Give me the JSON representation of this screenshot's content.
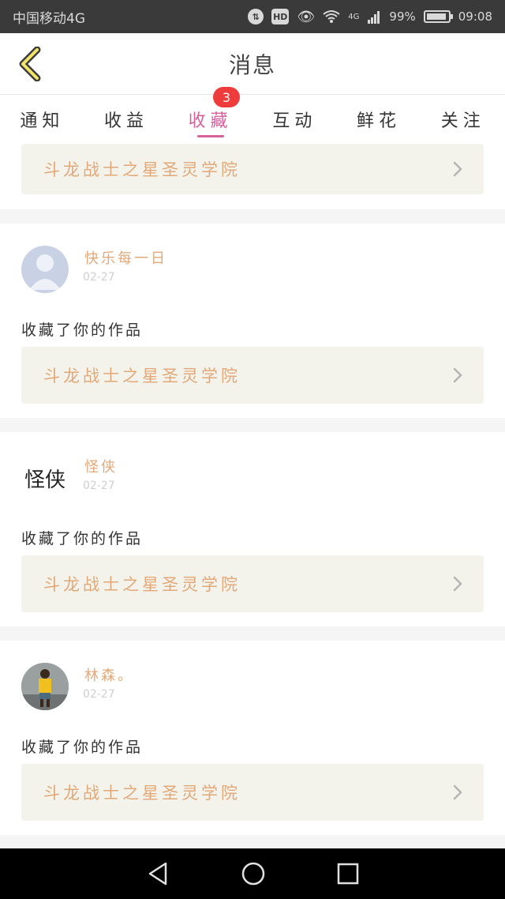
{
  "status_bar": {
    "carrier": "中国移动4G",
    "network_type": "4G",
    "battery": "99%",
    "time": "09:08",
    "icons": [
      "data-saver-icon",
      "hd-icon",
      "eye-icon",
      "wifi-icon",
      "signal-icon",
      "battery-icon"
    ]
  },
  "header": {
    "title": "消息",
    "back_icon": "chevron-left-icon"
  },
  "tabs": [
    {
      "label": "通知"
    },
    {
      "label": "收益"
    },
    {
      "label": "收藏",
      "badge": "3",
      "active": true
    },
    {
      "label": "互动"
    },
    {
      "label": "鲜花"
    },
    {
      "label": "关注"
    }
  ],
  "feed": {
    "partial_item": {
      "work_title": "斗龙战士之星圣灵学院"
    },
    "items": [
      {
        "username": "快乐每一日",
        "date": "02-27",
        "action": "收藏了你的作品",
        "work_title": "斗龙战士之星圣灵学院",
        "avatar": "default-avatar"
      },
      {
        "username": "怪侠",
        "avatar_text": "怪侠",
        "date": "02-27",
        "action": "收藏了你的作品",
        "work_title": "斗龙战士之星圣灵学院",
        "avatar": "calligraphy-avatar"
      },
      {
        "username": "林森。",
        "date": "02-27",
        "action": "收藏了你的作品",
        "work_title": "斗龙战士之星圣灵学院",
        "avatar": "photo-avatar"
      }
    ]
  },
  "colors": {
    "accent_pink": "#d7619b",
    "badge_red": "#ee3b3b",
    "work_title": "#e3a878",
    "card_link_bg": "#f3f3ec"
  }
}
